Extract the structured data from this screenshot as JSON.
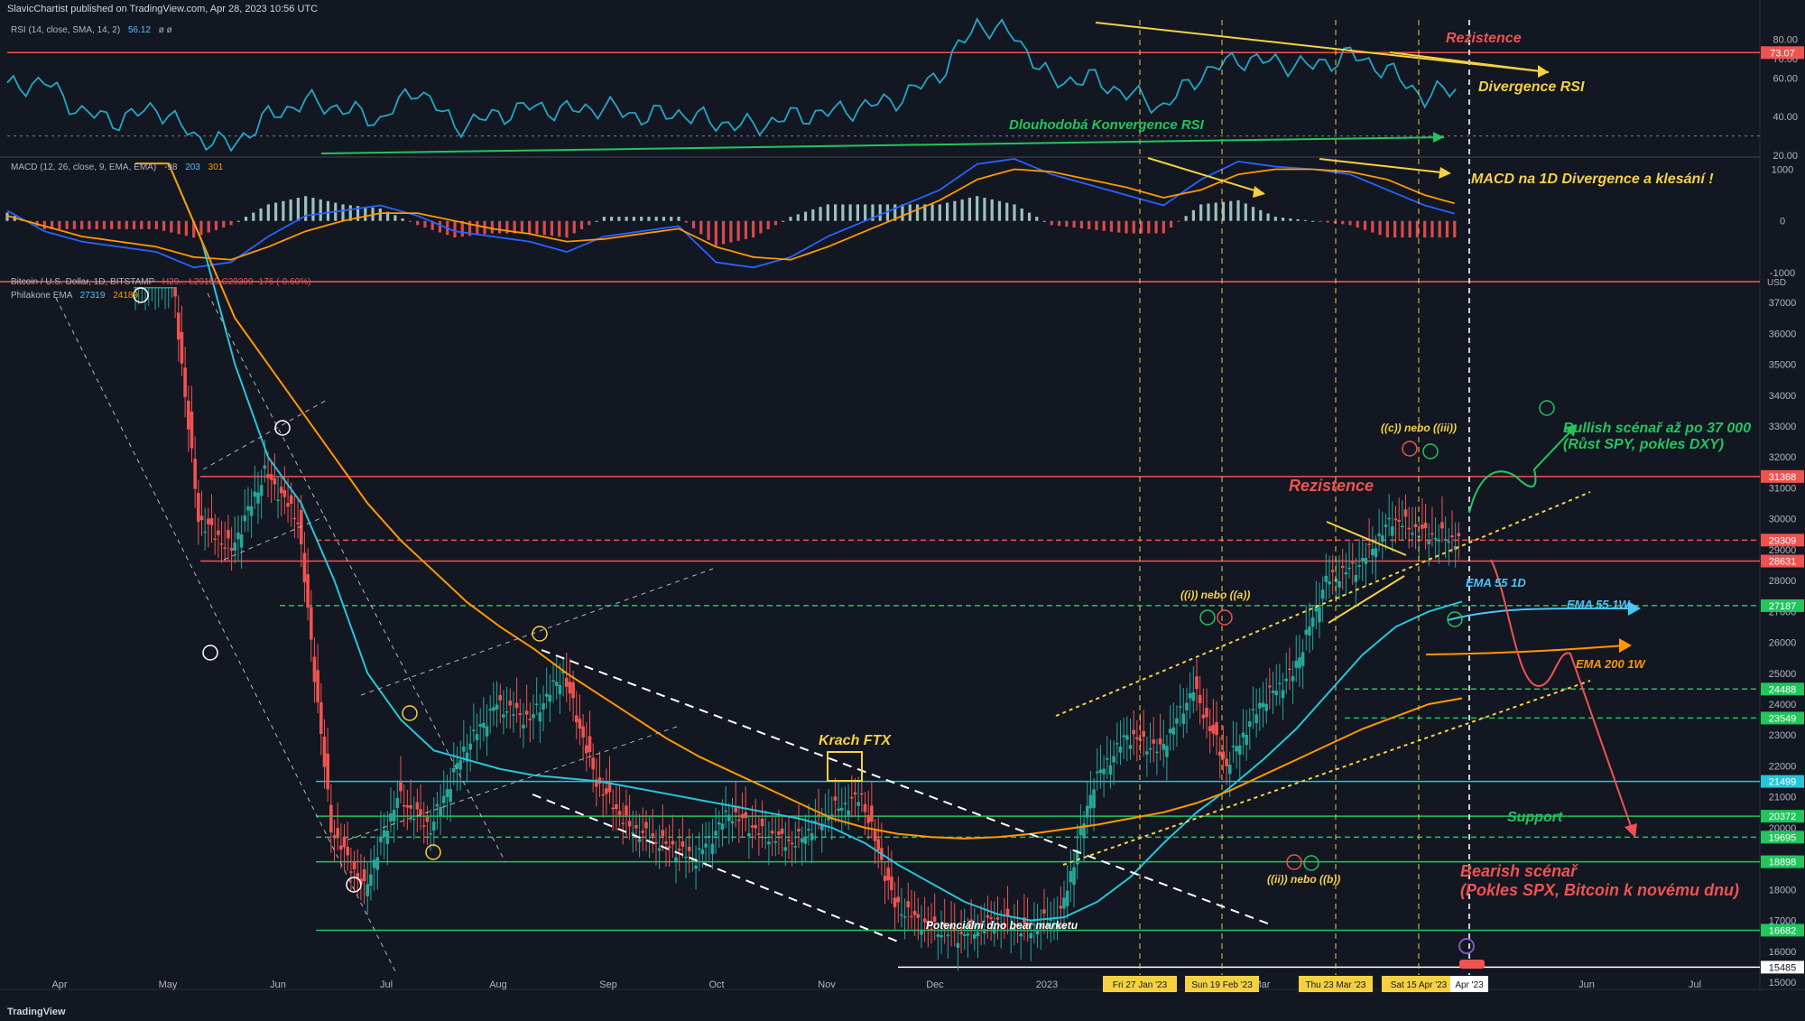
{
  "header": {
    "published": "SlavicChartist published on TradingView.com, Apr 28, 2023 10:56 UTC",
    "rsi_label": "RSI (14, close, SMA, 14, 2)",
    "rsi_value": "56.12",
    "rsi_extra": "ø ø",
    "macd_label": "MACD (12, 26, close, 9, EMA, EMA)",
    "macd_v1": "-98",
    "macd_v2": "203",
    "macd_v3": "301",
    "price_label": "Bitcoin / U.S. Dollar, 1D, BITSTAMP",
    "price_values": "H29... L29159 C29309 -176 (-0.60%)",
    "ema_label": "Philakone EMA",
    "ema_v1": "27319",
    "ema_v2": "24189",
    "usd": "USD",
    "footer": "TradingView"
  },
  "annotations": {
    "rezistence_top": "Rezistence",
    "divergence_rsi": "Divergence RSI",
    "konvergence_rsi": "Dlouhodobá Konvergence RSI",
    "macd_div": "MACD na 1D  Divergence a klesání !",
    "bullish": "Bullish scénař až po 37 000",
    "bullish2": "(Růst SPY, pokles DXY)",
    "rezistence": "Rezistence",
    "ema55_1d": "EMA 55 1D",
    "ema55_1w": "EMA 55 1W",
    "ema200_1w": "EMA 200 1W",
    "support": "Support",
    "bearish": "Bearish scénař",
    "bearish2": "(Pokles SPX, Bitcoin k novému dnu)",
    "krach": "Krach FTX",
    "dno": "Potenciální dno bear marketu",
    "wave_cc": "((c)) nebo ((iii))",
    "wave_ia": "((i)) nebo ((a))",
    "wave_iib": "((ii)) nebo ((b))"
  },
  "chart_data": [
    {
      "type": "line",
      "title": "RSI (14, close, SMA, 14, 2)",
      "ylim": [
        20,
        90
      ],
      "y_ticks": [
        "80.00",
        "70.00",
        "60.00",
        "40.00",
        "20.00"
      ],
      "levels": {
        "resistance": "73.07"
      },
      "series": [
        {
          "name": "RSI",
          "values": [
            55,
            58,
            42,
            38,
            45,
            30,
            25,
            40,
            48,
            44,
            38,
            55,
            35,
            40,
            45,
            43,
            45,
            40,
            42,
            37,
            35,
            40,
            42,
            45,
            50,
            62,
            88,
            82,
            58,
            60,
            52,
            45,
            62,
            70,
            68,
            66,
            72,
            64,
            50,
            56
          ]
        }
      ]
    },
    {
      "type": "bar",
      "title": "MACD (12, 26, close, 9, EMA, EMA)",
      "ylim": [
        -1000,
        1200
      ],
      "y_ticks": [
        "1000",
        "0",
        "-1000"
      ],
      "series": [
        {
          "name": "MACD",
          "values": [
            200,
            -200,
            -400,
            -500,
            -600,
            -900,
            -800,
            -300,
            100,
            200,
            300,
            100,
            -200,
            -300,
            -400,
            -600,
            -300,
            -200,
            -100,
            -800,
            -900,
            -700,
            -300,
            0,
            300,
            600,
            1100,
            1200,
            900,
            700,
            500,
            300,
            800,
            1150,
            1050,
            1000,
            900,
            600,
            300,
            100
          ]
        },
        {
          "name": "Signal",
          "values": [
            100,
            -100,
            -300,
            -400,
            -500,
            -700,
            -750,
            -500,
            -200,
            0,
            150,
            150,
            0,
            -150,
            -250,
            -400,
            -350,
            -250,
            -150,
            -500,
            -700,
            -750,
            -500,
            -200,
            100,
            400,
            800,
            1000,
            950,
            800,
            650,
            450,
            600,
            900,
            1000,
            1000,
            950,
            800,
            500,
            300
          ]
        }
      ]
    },
    {
      "type": "line",
      "title": "Bitcoin / U.S. Dollar, 1D, BITSTAMP",
      "ylabel": "USD",
      "ylim": [
        15000,
        37500
      ],
      "x_ticks": [
        "Apr",
        "May",
        "Jun",
        "Jul",
        "Aug",
        "Sep",
        "Oct",
        "Nov",
        "Dec",
        "2023",
        "Feb",
        "Mar",
        "Apr",
        "May",
        "Jun",
        "Jul"
      ],
      "x_date_labels": [
        "Fri 27 Jan '23",
        "Sun 19 Feb '23",
        "Thu 23 Mar '23",
        "Sat 15 Apr '23",
        "Apr '23"
      ],
      "y_ticks": [
        "37000",
        "36000",
        "35000",
        "34000",
        "33000",
        "32000",
        "31000",
        "30000",
        "29000",
        "28000",
        "27000",
        "26000",
        "25000",
        "24000",
        "23000",
        "22000",
        "21000",
        "20000",
        "19000",
        "18000",
        "17000",
        "16000",
        "15000"
      ],
      "price_levels": [
        "31368",
        "29309",
        "28631",
        "27187",
        "24488",
        "23549",
        "21499",
        "20372",
        "19695",
        "18898",
        "16682",
        "15485"
      ],
      "series": [
        {
          "name": "BTC",
          "values": [
            45000,
            40000,
            30000,
            29000,
            31500,
            30000,
            20000,
            18000,
            21000,
            20000,
            22500,
            24000,
            23500,
            25000,
            21500,
            20000,
            19500,
            19000,
            20500,
            19800,
            19500,
            20500,
            21000,
            17500,
            16800,
            16500,
            17000,
            16700,
            17200,
            21500,
            23000,
            22500,
            24500,
            22000,
            24000,
            25000,
            28000,
            28500,
            30000,
            29500,
            29309
          ]
        },
        {
          "name": "EMA 55 1D",
          "values": [
            45000,
            43000,
            39000,
            35000,
            32000,
            30500,
            28000,
            25000,
            23500,
            22500,
            22200,
            21900,
            21700,
            21600,
            21500,
            21300,
            21100,
            20900,
            20700,
            20500,
            20300,
            20000,
            19500,
            18800,
            18200,
            17600,
            17200,
            17000,
            17100,
            17600,
            18400,
            19500,
            20500,
            21300,
            22200,
            23200,
            24400,
            25600,
            26500,
            27000,
            27319
          ]
        },
        {
          "name": "EMA 200 1W",
          "values": [
            44000,
            42000,
            39000,
            36500,
            35000,
            33500,
            32000,
            30500,
            29300,
            28300,
            27300,
            26500,
            25800,
            25000,
            24300,
            23600,
            22900,
            22300,
            21800,
            21300,
            20800,
            20300,
            20000,
            19800,
            19700,
            19650,
            19700,
            19800,
            19950,
            20100,
            20300,
            20500,
            20800,
            21200,
            21700,
            22200,
            22700,
            23200,
            23600,
            24000,
            24189
          ]
        }
      ]
    }
  ]
}
